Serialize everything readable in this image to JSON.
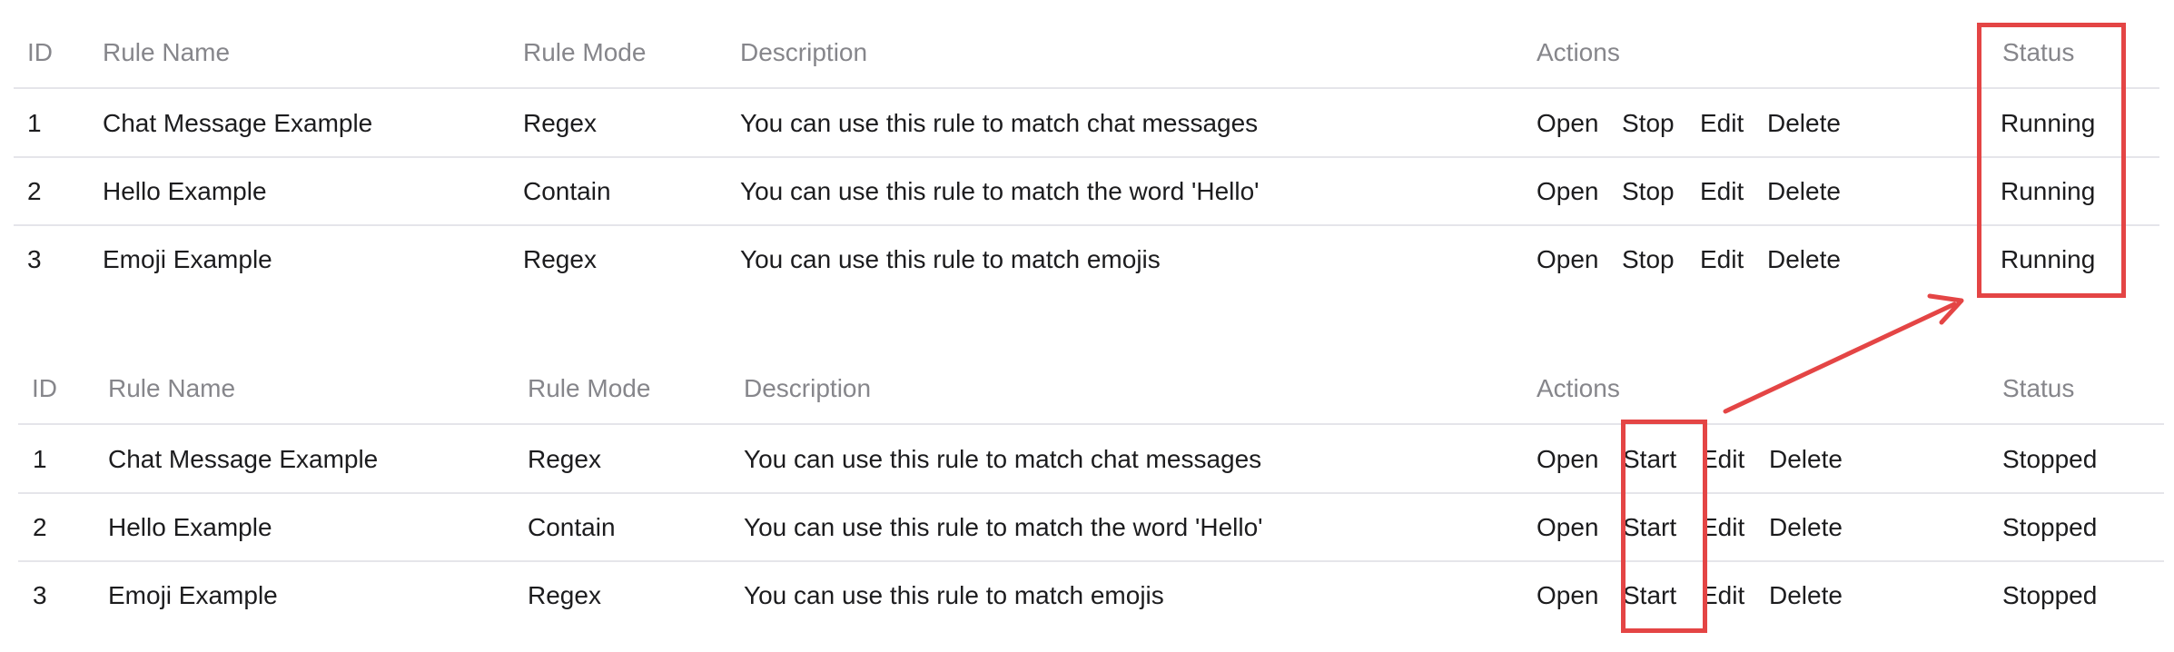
{
  "headers": {
    "id": "ID",
    "rule_name": "Rule Name",
    "rule_mode": "Rule Mode",
    "description": "Description",
    "actions": "Actions",
    "status": "Status"
  },
  "table_running": {
    "rows": [
      {
        "id": "1",
        "name": "Chat Message Example",
        "mode": "Regex",
        "description": "You can use this rule to match chat messages",
        "actions": [
          "Open",
          "Stop",
          "Edit",
          "Delete"
        ],
        "status": "Running"
      },
      {
        "id": "2",
        "name": "Hello Example",
        "mode": "Contain",
        "description": "You can use this rule to match the word 'Hello'",
        "actions": [
          "Open",
          "Stop",
          "Edit",
          "Delete"
        ],
        "status": "Running"
      },
      {
        "id": "3",
        "name": "Emoji Example",
        "mode": "Regex",
        "description": "You can use this rule to match emojis",
        "actions": [
          "Open",
          "Stop",
          "Edit",
          "Delete"
        ],
        "status": "Running"
      }
    ]
  },
  "table_stopped": {
    "rows": [
      {
        "id": "1",
        "name": "Chat Message Example",
        "mode": "Regex",
        "description": "You can use this rule to match chat messages",
        "actions": [
          "Open",
          "Start",
          "Edit",
          "Delete"
        ],
        "status": "Stopped"
      },
      {
        "id": "2",
        "name": "Hello Example",
        "mode": "Contain",
        "description": "You can use this rule to match the word 'Hello'",
        "actions": [
          "Open",
          "Start",
          "Edit",
          "Delete"
        ],
        "status": "Stopped"
      },
      {
        "id": "3",
        "name": "Emoji Example",
        "mode": "Regex",
        "description": "You can use this rule to match emojis",
        "actions": [
          "Open",
          "Start",
          "Edit",
          "Delete"
        ],
        "status": "Stopped"
      }
    ]
  },
  "annotation": {
    "color": "#e44545"
  }
}
